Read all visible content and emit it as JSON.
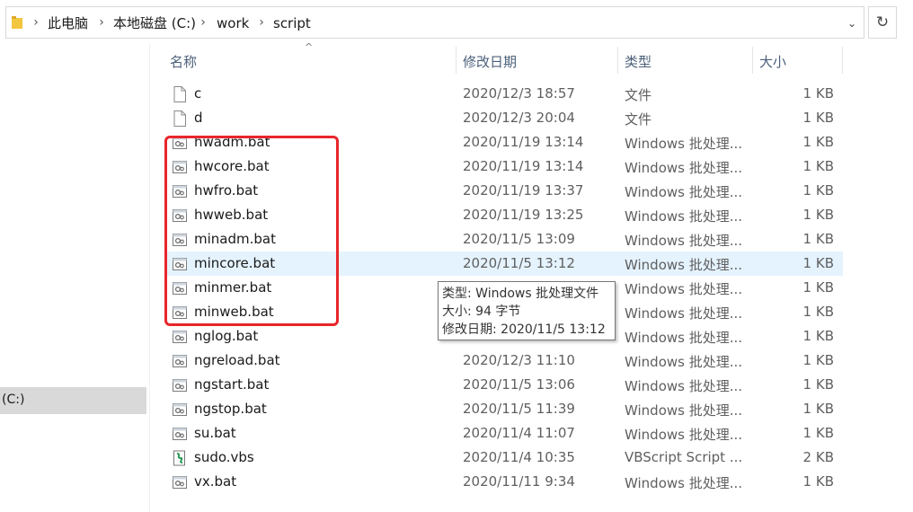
{
  "breadcrumb": {
    "items": [
      "此电脑",
      "本地磁盘 (C:)",
      "work",
      "script"
    ],
    "separator": "›"
  },
  "nav": {
    "selected_label": "(C:)"
  },
  "columns": {
    "name": "名称",
    "date": "修改日期",
    "type": "类型",
    "size": "大小"
  },
  "files": [
    {
      "name": "c",
      "date": "2020/12/3 18:57",
      "type": "文件",
      "size": "1 KB",
      "icon": "file-icon"
    },
    {
      "name": "d",
      "date": "2020/12/3 20:04",
      "type": "文件",
      "size": "1 KB",
      "icon": "file-icon"
    },
    {
      "name": "hwadm.bat",
      "date": "2020/11/19 13:14",
      "type": "Windows 批处理...",
      "size": "1 KB",
      "icon": "batch-file-icon"
    },
    {
      "name": "hwcore.bat",
      "date": "2020/11/19 13:14",
      "type": "Windows 批处理...",
      "size": "1 KB",
      "icon": "batch-file-icon"
    },
    {
      "name": "hwfro.bat",
      "date": "2020/11/19 13:37",
      "type": "Windows 批处理...",
      "size": "1 KB",
      "icon": "batch-file-icon"
    },
    {
      "name": "hwweb.bat",
      "date": "2020/11/19 13:25",
      "type": "Windows 批处理...",
      "size": "1 KB",
      "icon": "batch-file-icon"
    },
    {
      "name": "minadm.bat",
      "date": "2020/11/5 13:09",
      "type": "Windows 批处理...",
      "size": "1 KB",
      "icon": "batch-file-icon"
    },
    {
      "name": "mincore.bat",
      "date": "2020/11/5 13:12",
      "type": "Windows 批处理...",
      "size": "1 KB",
      "icon": "batch-file-icon",
      "hover": true
    },
    {
      "name": "minmer.bat",
      "date": "",
      "type": "Windows 批处理...",
      "size": "1 KB",
      "icon": "batch-file-icon"
    },
    {
      "name": "minweb.bat",
      "date": "",
      "type": "Windows 批处理...",
      "size": "1 KB",
      "icon": "batch-file-icon"
    },
    {
      "name": "nglog.bat",
      "date": "",
      "type": "Windows 批处理...",
      "size": "1 KB",
      "icon": "batch-file-icon"
    },
    {
      "name": "ngreload.bat",
      "date": "2020/12/3 11:10",
      "type": "Windows 批处理...",
      "size": "1 KB",
      "icon": "batch-file-icon"
    },
    {
      "name": "ngstart.bat",
      "date": "2020/11/5 13:06",
      "type": "Windows 批处理...",
      "size": "1 KB",
      "icon": "batch-file-icon"
    },
    {
      "name": "ngstop.bat",
      "date": "2020/11/5 11:39",
      "type": "Windows 批处理...",
      "size": "1 KB",
      "icon": "batch-file-icon"
    },
    {
      "name": "su.bat",
      "date": "2020/11/4 11:07",
      "type": "Windows 批处理...",
      "size": "1 KB",
      "icon": "batch-file-icon"
    },
    {
      "name": "sudo.vbs",
      "date": "2020/11/4 10:35",
      "type": "VBScript Script ...",
      "size": "2 KB",
      "icon": "vbscript-file-icon"
    },
    {
      "name": "vx.bat",
      "date": "2020/11/11 9:34",
      "type": "Windows 批处理...",
      "size": "1 KB",
      "icon": "batch-file-icon"
    }
  ],
  "tooltip": {
    "line1": "类型: Windows 批处理文件",
    "line2": "大小: 94 字节",
    "line3": "修改日期: 2020/11/5 13:12"
  },
  "colors": {
    "hover_row": "#e5f3ff",
    "annotation_red": "#e8262b",
    "header_text": "#4c607a",
    "folder_yellow": "#f3c640"
  }
}
